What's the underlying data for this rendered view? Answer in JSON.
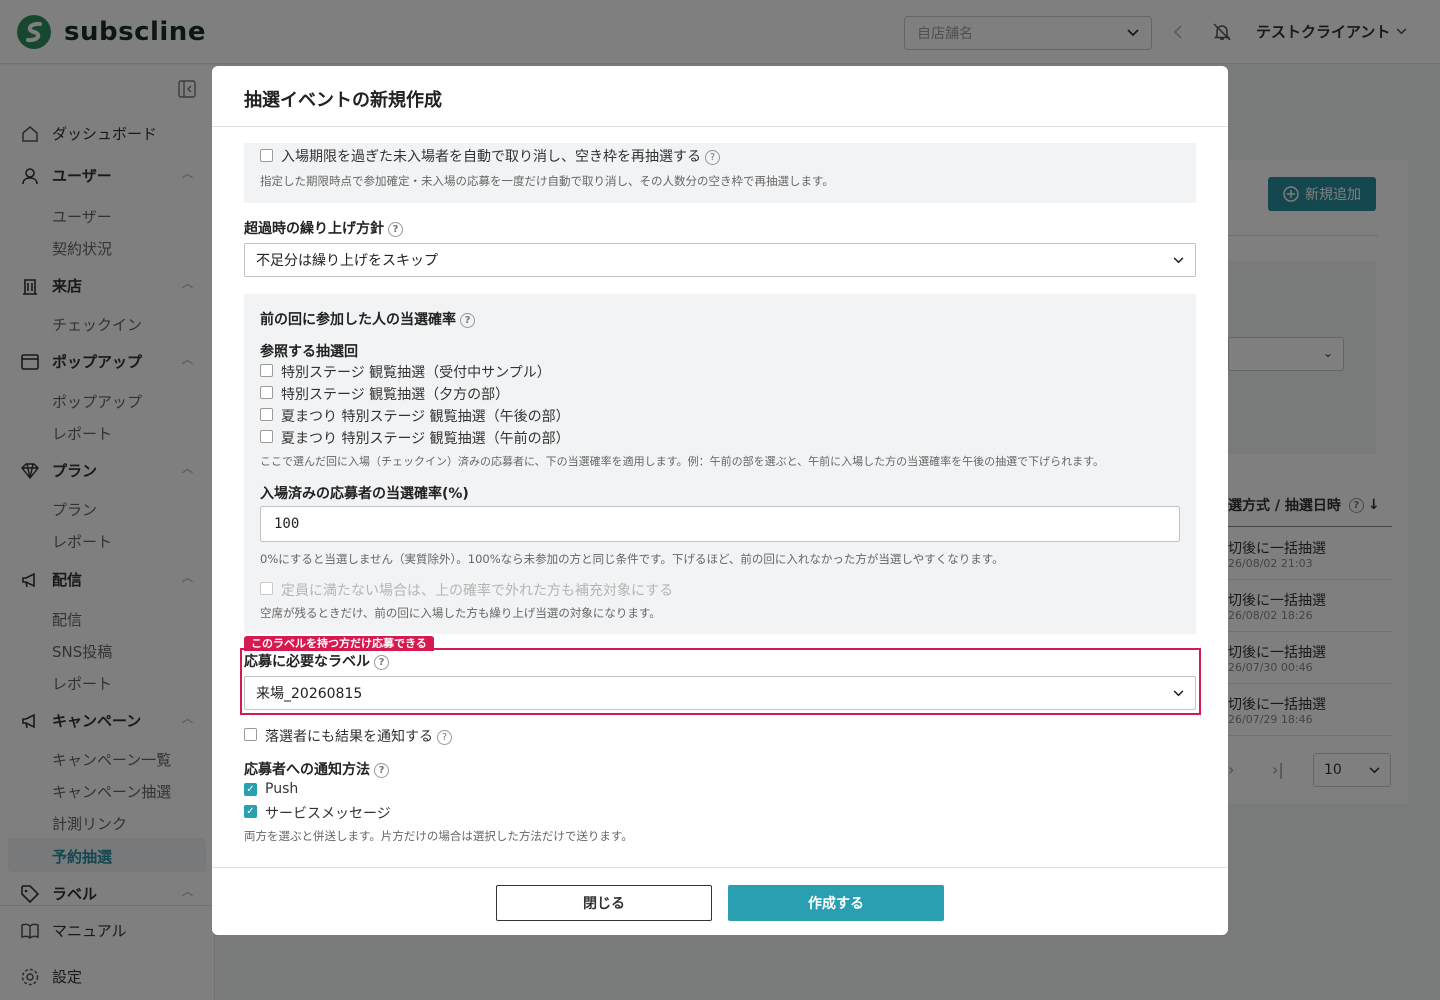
{
  "app": {
    "name": "subscline"
  },
  "header": {
    "store_placeholder": "自店舗名",
    "client_name": "テストクライアント"
  },
  "sidebar": {
    "dashboard": "ダッシュボード",
    "users_section": "ユーザー",
    "users_sub": [
      "ユーザー",
      "契約状況"
    ],
    "visit_section": "来店",
    "visit_sub": [
      "チェックイン"
    ],
    "popup_section": "ポップアップ",
    "popup_sub": [
      "ポップアップ",
      "レポート"
    ],
    "plan_section": "プラン",
    "plan_sub": [
      "プラン",
      "レポート"
    ],
    "delivery_section": "配信",
    "delivery_sub": [
      "配信",
      "SNS投稿",
      "レポート"
    ],
    "campaign_section": "キャンペーン",
    "campaign_sub": [
      "キャンペーン一覧",
      "キャンペーン抽選",
      "計測リンク",
      "予約抽選"
    ],
    "label_section": "ラベル",
    "manual": "マニュアル",
    "settings": "設定"
  },
  "background": {
    "add_button": "新規追加",
    "column_header": "選方式 / 抽選日時",
    "rows": [
      {
        "t1": "切後に一括抽選",
        "t2": "26/08/02 21:03"
      },
      {
        "t1": "切後に一括抽選",
        "t2": "26/08/02 18:26"
      },
      {
        "t1": "切後に一括抽選",
        "t2": "26/07/30 00:46"
      },
      {
        "t1": "切後に一括抽選",
        "t2": "26/07/29 18:46"
      }
    ],
    "per_page": "10"
  },
  "modal": {
    "title": "抽選イベントの新規作成",
    "auto_cancel": {
      "label": "入場期限を過ぎた未入場者を自動で取り消し、空き枠を再抽選する",
      "help": "指定した期限時点で参加確定・未入場の応募を一度だけ自動で取り消し、その人数分の空き枠で再抽選します。"
    },
    "overflow_policy": {
      "label": "超過時の繰り上げ方針",
      "value": "不足分は繰り上げをスキップ"
    },
    "previous": {
      "title": "前の回に参加した人の当選確率",
      "ref_label": "参照する抽選回",
      "options": [
        "特別ステージ 観覧抽選（受付中サンプル）",
        "特別ステージ 観覧抽選（夕方の部）",
        "夏まつり 特別ステージ 観覧抽選（午後の部）",
        "夏まつり 特別ステージ 観覧抽選（午前の部）"
      ],
      "ref_help": "ここで選んだ回に入場（チェックイン）済みの応募者に、下の当選確率を適用します。例：午前の部を選ぶと、午前に入場した方の当選確率を午後の抽選で下げられます。",
      "rate_label": "入場済みの応募者の当選確率(%)",
      "rate_value": "100",
      "rate_help": "0%にすると当選しません（実質除外）。100%なら未参加の方と同じ条件です。下げるほど、前の回に入れなかった方が当選しやすくなります。",
      "supplement_label": "定員に満たない場合は、上の確率で外れた方も補充対象にする",
      "supplement_help": "空席が残るときだけ、前の回に入場した方も繰り上げ当選の対象になります。"
    },
    "required_label": {
      "tag": "このラベルを持つ方だけ応募できる",
      "label": "応募に必要なラベル",
      "value": "来場_20260815"
    },
    "notify_losers": "落選者にも結果を通知する",
    "notify_method": {
      "label": "応募者への通知方法",
      "options": [
        "Push",
        "サービスメッセージ"
      ],
      "help": "両方を選ぶと併送します。片方だけの場合は選択した方法だけで送ります。"
    },
    "close_button": "閉じる",
    "create_button": "作成する"
  },
  "colors": {
    "accent": "#2a9fb1",
    "highlight": "#d6194e"
  }
}
